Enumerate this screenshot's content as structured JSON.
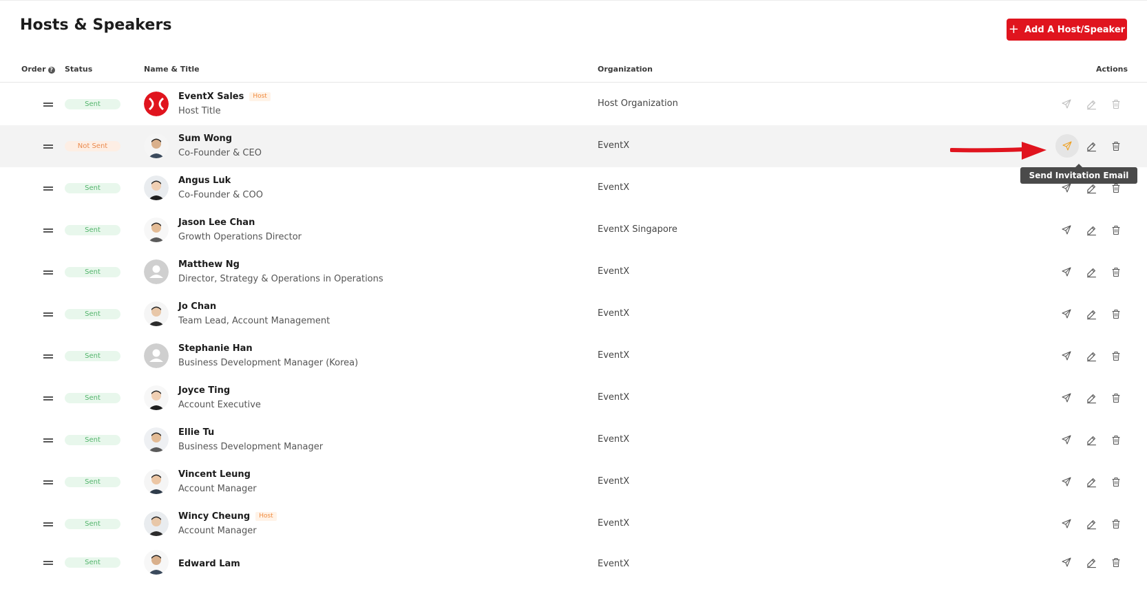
{
  "page": {
    "title": "Hosts & Speakers",
    "add_button_label": "Add A Host/Speaker",
    "accent_color": "#e0141e"
  },
  "table": {
    "headers": {
      "order": "Order",
      "status": "Status",
      "name_title": "Name & Title",
      "organization": "Organization",
      "actions": "Actions"
    },
    "rows": [
      {
        "status": "Sent",
        "name": "EventX Sales",
        "tag": "Host",
        "title": "Host Title",
        "organization": "Host Organization",
        "avatar": "eventx-logo"
      },
      {
        "status": "Not Sent",
        "name": "Sum Wong",
        "tag": "",
        "title": "Co-Founder & CEO",
        "organization": "EventX",
        "avatar": "photo"
      },
      {
        "status": "Sent",
        "name": "Angus Luk",
        "tag": "",
        "title": "Co-Founder & COO",
        "organization": "EventX",
        "avatar": "photo"
      },
      {
        "status": "Sent",
        "name": "Jason Lee Chan",
        "tag": "",
        "title": "Growth Operations Director",
        "organization": "EventX Singapore",
        "avatar": "photo"
      },
      {
        "status": "Sent",
        "name": "Matthew Ng",
        "tag": "",
        "title": "Director, Strategy & Operations in Operations",
        "organization": "EventX",
        "avatar": "placeholder"
      },
      {
        "status": "Sent",
        "name": "Jo Chan",
        "tag": "",
        "title": "Team Lead, Account Management",
        "organization": "EventX",
        "avatar": "photo"
      },
      {
        "status": "Sent",
        "name": "Stephanie Han",
        "tag": "",
        "title": "Business Development Manager (Korea)",
        "organization": "EventX",
        "avatar": "placeholder"
      },
      {
        "status": "Sent",
        "name": "Joyce Ting",
        "tag": "",
        "title": "Account Executive",
        "organization": "EventX",
        "avatar": "photo"
      },
      {
        "status": "Sent",
        "name": "Ellie Tu",
        "tag": "",
        "title": "Business Development Manager",
        "organization": "EventX",
        "avatar": "photo"
      },
      {
        "status": "Sent",
        "name": "Vincent Leung",
        "tag": "",
        "title": "Account Manager",
        "organization": "EventX",
        "avatar": "photo"
      },
      {
        "status": "Sent",
        "name": "Wincy Cheung",
        "tag": "Host",
        "title": "Account Manager",
        "organization": "EventX",
        "avatar": "photo"
      },
      {
        "status": "Sent",
        "name": "Edward Lam",
        "tag": "",
        "title": "",
        "organization": "EventX",
        "avatar": "photo"
      }
    ]
  },
  "tooltip": {
    "text": "Send Invitation Email"
  },
  "icons": {
    "send": "paper-plane-icon",
    "edit": "pencil-icon",
    "delete": "trash-icon",
    "drag": "drag-handle-icon",
    "help": "question-circle-icon"
  }
}
